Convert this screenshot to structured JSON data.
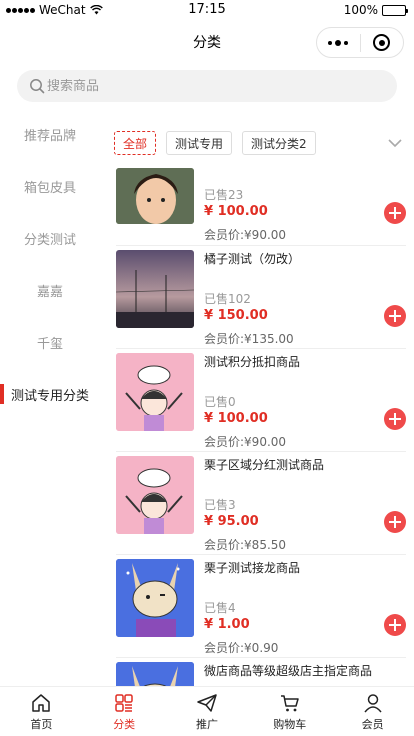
{
  "status": {
    "carrier": "WeChat",
    "time": "17:15",
    "battery": "100%"
  },
  "nav": {
    "title": "分类"
  },
  "search": {
    "placeholder": "搜索商品"
  },
  "sidebar": {
    "items": [
      {
        "label": "推荐品牌"
      },
      {
        "label": "箱包皮具"
      },
      {
        "label": "分类测试"
      },
      {
        "label": "嘉嘉"
      },
      {
        "label": "千玺"
      },
      {
        "label": "测试专用分类"
      }
    ]
  },
  "filters": {
    "chips": [
      "全部",
      "测试专用",
      "测试分类2"
    ]
  },
  "products": [
    {
      "name": "",
      "sold": "已售23",
      "price": "¥ 100.00",
      "member": "会员价:¥90.00"
    },
    {
      "name": "橘子测试（勿改）",
      "sold": "已售102",
      "price": "¥ 150.00",
      "member": "会员价:¥135.00"
    },
    {
      "name": "测试积分抵扣商品",
      "sold": "已售0",
      "price": "¥ 100.00",
      "member": "会员价:¥90.00"
    },
    {
      "name": "栗子区域分红测试商品",
      "sold": "已售3",
      "price": "¥ 95.00",
      "member": "会员价:¥85.50"
    },
    {
      "name": "栗子测试接龙商品",
      "sold": "已售4",
      "price": "¥ 1.00",
      "member": "会员价:¥0.90"
    },
    {
      "name": "微店商品等级超级店主指定商品",
      "sold": "",
      "price": "",
      "member": ""
    }
  ],
  "tabbar": {
    "tabs": [
      {
        "label": "首页",
        "icon": "home-icon"
      },
      {
        "label": "分类",
        "icon": "category-icon"
      },
      {
        "label": "推广",
        "icon": "paper-plane-icon"
      },
      {
        "label": "购物车",
        "icon": "cart-icon"
      },
      {
        "label": "会员",
        "icon": "user-icon"
      }
    ]
  },
  "colors": {
    "accent": "#e02e24",
    "add_button": "#ef4a4a"
  }
}
